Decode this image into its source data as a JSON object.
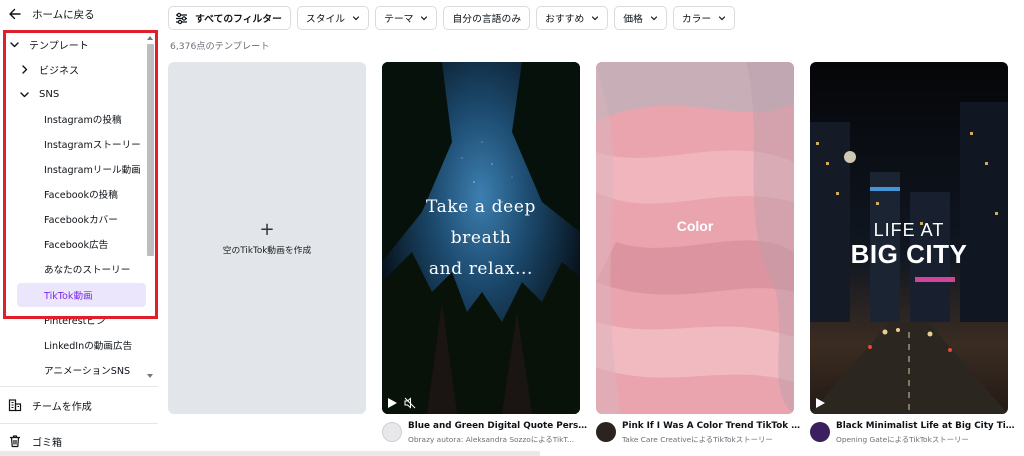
{
  "sidebar": {
    "back_label": "ホームに戻る",
    "tree": {
      "templates": "テンプレート",
      "business": "ビジネス",
      "sns": "SNS",
      "items": [
        "Instagramの投稿",
        "Instagramストーリー",
        "Instagramリール動画",
        "Facebookの投稿",
        "Facebookカバー",
        "Facebook広告",
        "あなたのストーリー",
        "TikTok動画",
        "Pinterestピン",
        "LinkedInの動画広告",
        "アニメーションSNS"
      ],
      "active_item": "TikTok動画"
    },
    "footer": {
      "create_team": "チームを作成",
      "trash": "ゴミ箱"
    }
  },
  "filters": {
    "all": "すべてのフィルター",
    "style": "スタイル",
    "theme": "テーマ",
    "own_language": "自分の言語のみ",
    "recommended": "おすすめ",
    "price": "価格",
    "color": "カラー"
  },
  "result_count": "6,376点のテンプレート",
  "blank_card": {
    "label": "空のTikTok動画を作成"
  },
  "templates": [
    {
      "overlay_lines": [
        "Take a deep",
        "breath",
        "and relax..."
      ],
      "title": "Blue and Green Digital Quote Person...",
      "author": "Obrazy autora: Aleksandra SozzoによるTikT..."
    },
    {
      "overlay_lines": [
        "Color"
      ],
      "title": "Pink If I Was A Color Trend TikTok St...",
      "author": "Take Care CreativeによるTikTokストーリー"
    },
    {
      "overlay_lines": [
        "LIFE AT",
        "BIG CITY"
      ],
      "title": "Black Minimalist Life at Big City TikT...",
      "author": "Opening GateによるTikTokストーリー"
    }
  ],
  "colors": {
    "highlight_border": "#e01f2b",
    "active_bg": "#ece6fd",
    "active_text": "#7d2ae8",
    "blank_card_bg": "#e2e5e9"
  },
  "icons": {
    "back": "arrow-left-icon",
    "expand": "chevron-down-icon",
    "collapse": "chevron-right-icon",
    "filters": "sliders-icon",
    "team": "team-building-icon",
    "trash": "trash-icon",
    "play": "play-icon",
    "mute": "mute-icon",
    "add": "plus-icon"
  }
}
